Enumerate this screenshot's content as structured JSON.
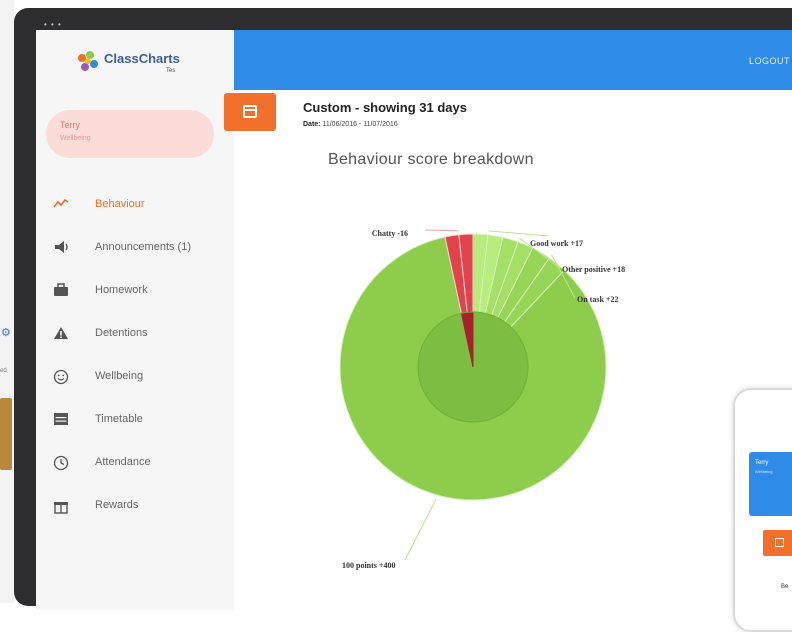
{
  "app": {
    "logo_text": "ClassCharts",
    "logo_sub": "Tes",
    "logout_label": "LOGOUT"
  },
  "user": {
    "name": "Terry",
    "subtitle": "Wellbeing"
  },
  "sidebar": {
    "items": [
      {
        "label": "Behaviour",
        "icon": "trend-line-icon",
        "active": true
      },
      {
        "label": "Announcements (1)",
        "icon": "megaphone-icon",
        "active": false
      },
      {
        "label": "Homework",
        "icon": "briefcase-icon",
        "active": false
      },
      {
        "label": "Detentions",
        "icon": "warning-icon",
        "active": false
      },
      {
        "label": "Wellbeing",
        "icon": "smiley-icon",
        "active": false
      },
      {
        "label": "Timetable",
        "icon": "table-icon",
        "active": false
      },
      {
        "label": "Attendance",
        "icon": "clock-icon",
        "active": false
      },
      {
        "label": "Rewards",
        "icon": "gift-icon",
        "active": false
      }
    ]
  },
  "content": {
    "range_title": "Custom - showing 31 days",
    "date_label": "Date:",
    "date_value": "11/06/2016 - 11/07/2016",
    "chart_title": "Behaviour score breakdown"
  },
  "chart_data": {
    "type": "pie",
    "title": "Behaviour score breakdown",
    "slices": [
      {
        "label": "100 points",
        "value": 400,
        "display": "100 points +400",
        "color": "#8ecc4c"
      },
      {
        "label": "Chatty",
        "value": -16,
        "display": "Chatty -16",
        "color": "#e2434b"
      },
      {
        "label": "Good work",
        "value": 17,
        "display": "Good work +17",
        "color": "#b8ec7d"
      },
      {
        "label": "Other positive",
        "value": 18,
        "display": "Other positive +18",
        "color": "#a4df66"
      },
      {
        "label": "On task",
        "value": 22,
        "display": "On task +22",
        "color": "#96d556"
      }
    ],
    "colors": {
      "positive": "#8ecc4c",
      "negative": "#e2434b"
    }
  },
  "phone": {
    "name": "Terry",
    "subtitle": "Wellbeing",
    "footer": "Be"
  },
  "background": {
    "tiny_text": "ed"
  }
}
